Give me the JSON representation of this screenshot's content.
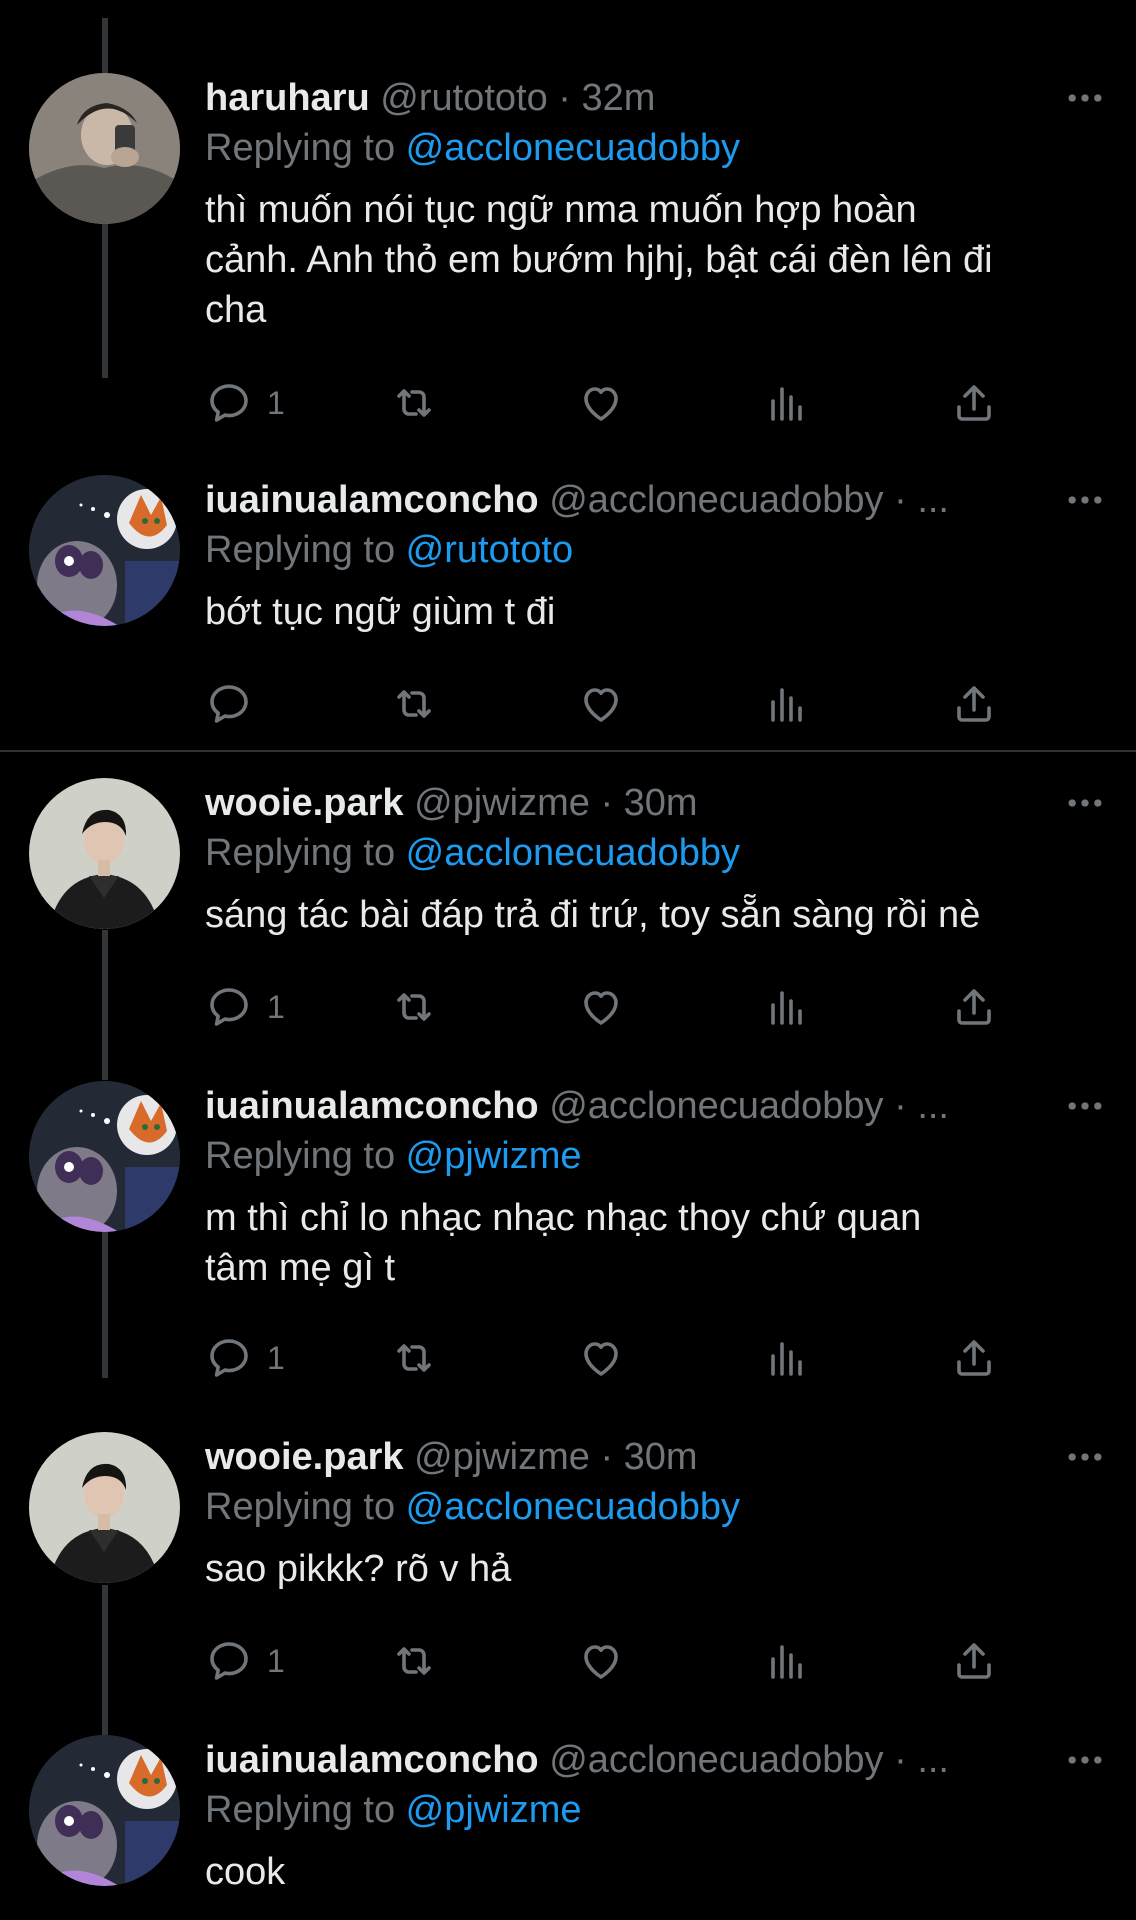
{
  "tweets": [
    {
      "name": "haruharu",
      "handle": "@rutototo",
      "time": "· 32m",
      "replying_prefix": "Replying to ",
      "replying_to": "@acclonecuadobby",
      "text": "thì muốn nói tục ngữ nma muốn hợp hoàn\ncảnh. Anh thỏ em bướm hjhj, bật cái đèn lên đi\ncha",
      "reply_count": "1"
    },
    {
      "name": "iuainualamconcho",
      "handle": "@acclonecuadobby",
      "time": "· ...",
      "replying_prefix": "Replying to ",
      "replying_to": "@rutototo",
      "text": "bớt tục ngữ giùm t đi",
      "reply_count": ""
    },
    {
      "name": "wooie.park",
      "handle": "@pjwizme",
      "time": "· 30m",
      "replying_prefix": "Replying to ",
      "replying_to": "@acclonecuadobby",
      "text": "sáng tác bài đáp trả đi trứ, toy sẵn sàng rồi nè",
      "reply_count": "1"
    },
    {
      "name": "iuainualamconcho",
      "handle": "@acclonecuadobby",
      "time": "· ...",
      "replying_prefix": "Replying to ",
      "replying_to": "@pjwizme",
      "text": "m thì chỉ lo nhạc nhạc nhạc thoy chứ quan\ntâm mẹ gì t",
      "reply_count": "1"
    },
    {
      "name": "wooie.park",
      "handle": "@pjwizme",
      "time": "· 30m",
      "replying_prefix": "Replying to ",
      "replying_to": "@acclonecuadobby",
      "text": "sao pikkk? rõ v hả",
      "reply_count": "1"
    },
    {
      "name": "iuainualamconcho",
      "handle": "@acclonecuadobby",
      "time": "· ...",
      "replying_prefix": "Replying to ",
      "replying_to": "@pjwizme",
      "text": "cook",
      "reply_count": ""
    }
  ],
  "icons": {
    "reply": "reply-icon",
    "retweet": "retweet-icon",
    "like": "heart-icon",
    "views": "views-icon",
    "share": "share-icon",
    "more": "more-icon"
  },
  "colors": {
    "background": "#000000",
    "text": "#e7e9ea",
    "secondary": "#71767b",
    "link": "#1d9bf0",
    "divider": "#2f3336"
  }
}
